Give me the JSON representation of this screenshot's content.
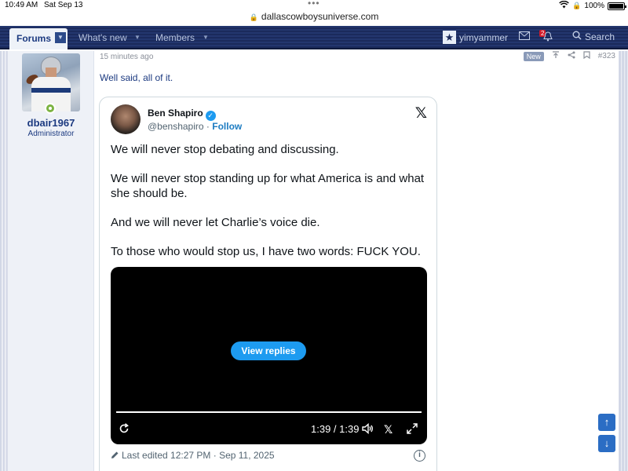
{
  "status_bar": {
    "time": "10:49 AM",
    "date": "Sat Sep 13",
    "battery": "100%"
  },
  "url_bar": {
    "url": "dallascowboysuniverse.com"
  },
  "nav": {
    "forums": "Forums",
    "whats_new": "What's new",
    "members": "Members",
    "username": "yimyammer",
    "alerts_count": "2",
    "search": "Search"
  },
  "post": {
    "time_ago": "15 minutes ago",
    "new_tag": "New",
    "post_number": "#323",
    "text": "Well said, all of it.",
    "author": {
      "username": "dbair1967",
      "title": "Administrator"
    }
  },
  "tweet": {
    "name": "Ben Shapiro",
    "handle": "@benshapiro",
    "follow": "Follow",
    "paragraphs": [
      "We will never stop debating and discussing.",
      "We will never stop standing up for what America is and what she should be.",
      "And we will never let Charlie’s voice die.",
      "To those who would stop us, I have two words: FUCK YOU."
    ],
    "video": {
      "view_replies": "View replies",
      "time": "1:39 / 1:39",
      "progress": 1.0
    },
    "footer": "Last edited 12:27 PM · Sep 11, 2025"
  },
  "colors": {
    "nav_bg": "#1b2a5c",
    "link_blue": "#1c3a80",
    "twitter_blue": "#1d9bf0",
    "online_green": "#7cb342"
  }
}
